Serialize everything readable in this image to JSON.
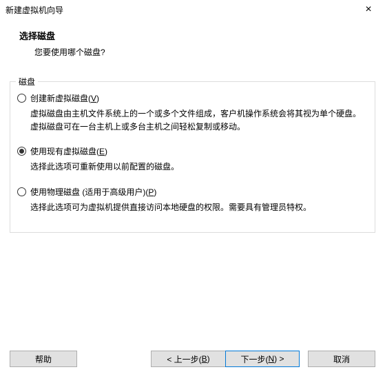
{
  "window": {
    "title": "新建虚拟机向导"
  },
  "header": {
    "title": "选择磁盘",
    "subtitle": "您要使用哪个磁盘?"
  },
  "fieldset": {
    "legend": "磁盘"
  },
  "options": {
    "create": {
      "label_pre": "创建新虚拟磁盘(",
      "accel": "V",
      "label_post": ")",
      "desc": "虚拟磁盘由主机文件系统上的一个或多个文件组成，客户机操作系统会将其视为单个硬盘。虚拟磁盘可在一台主机上或多台主机之间轻松复制或移动。",
      "checked": false
    },
    "existing": {
      "label_pre": "使用现有虚拟磁盘(",
      "accel": "E",
      "label_post": ")",
      "desc": "选择此选项可重新使用以前配置的磁盘。",
      "checked": true
    },
    "physical": {
      "label_pre": "使用物理磁盘 (适用于高级用户)(",
      "accel": "P",
      "label_post": ")",
      "desc": "选择此选项可为虚拟机提供直接访问本地硬盘的权限。需要具有管理员特权。",
      "checked": false
    }
  },
  "buttons": {
    "help": "帮助",
    "back_pre": "< 上一步(",
    "back_accel": "B",
    "back_post": ")",
    "next_pre": "下一步(",
    "next_accel": "N",
    "next_post": ") >",
    "cancel": "取消"
  }
}
